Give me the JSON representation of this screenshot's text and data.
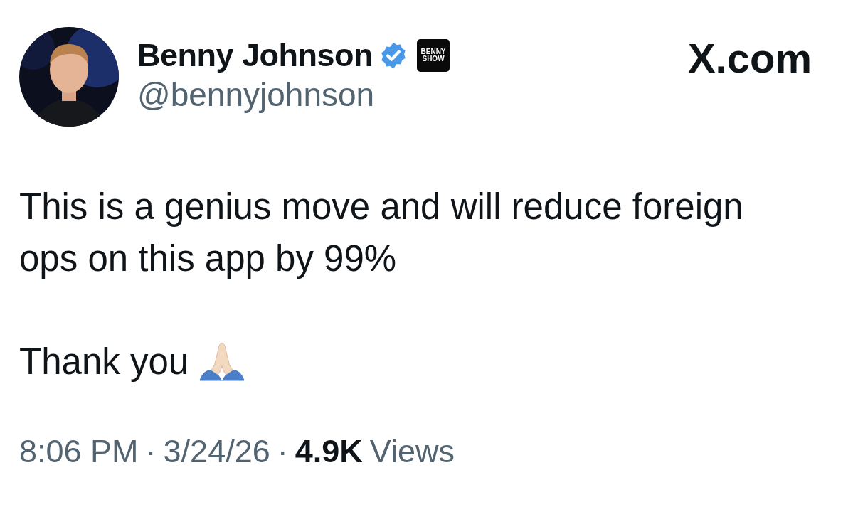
{
  "author": {
    "name": "Benny Johnson",
    "verified": true,
    "affiliate_badge": [
      "BENNY",
      "SHOW"
    ],
    "handle": "@bennyjohnson"
  },
  "site_label": "X.com",
  "post": {
    "paragraphs": [
      "This is a genius move and will reduce foreign ops on this app by 99%",
      "Thank you"
    ]
  },
  "footer": {
    "time": "8:06 PM",
    "separator_1": "·",
    "date": "3/24/26",
    "separator_2": "·",
    "views_count": "4.9K",
    "views_label": "Views"
  }
}
